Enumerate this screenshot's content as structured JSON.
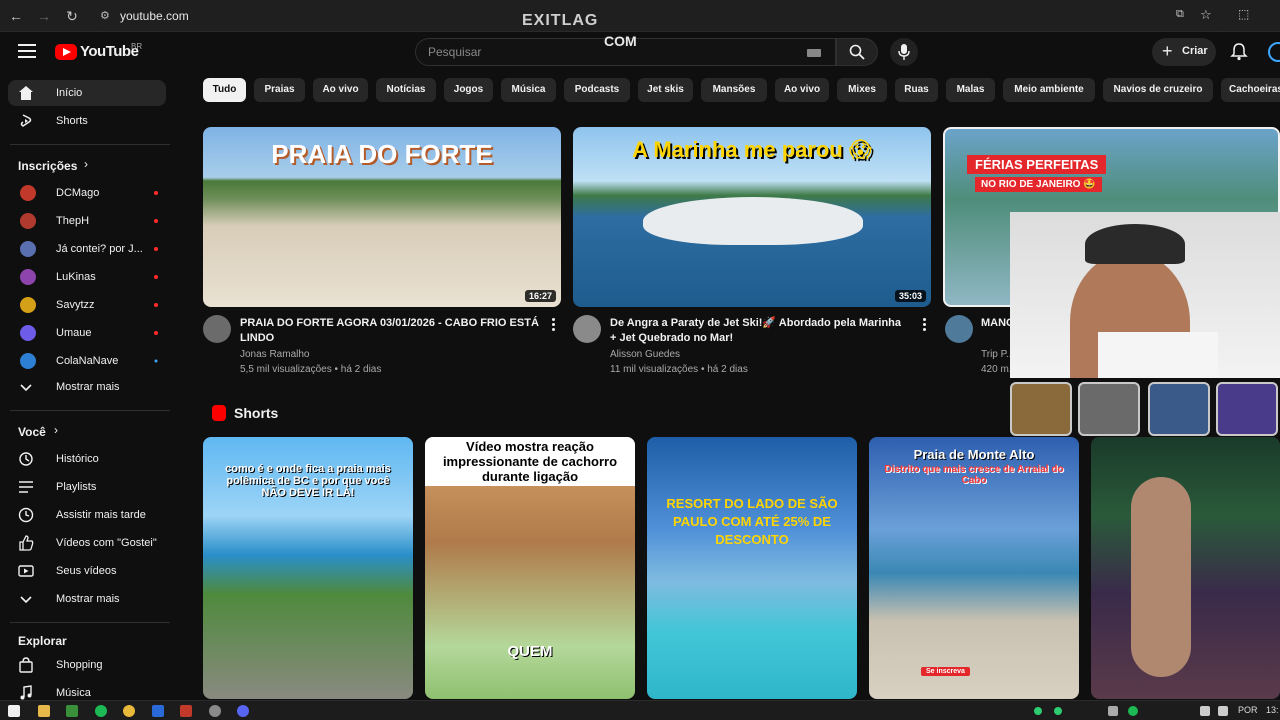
{
  "browser": {
    "url": "youtube.com",
    "overlay_logo": "EXITLAG",
    "overlay_sub": "COM"
  },
  "header": {
    "logo_text": "YouTube",
    "country_code": "BR",
    "search_placeholder": "Pesquisar",
    "create_label": "Criar"
  },
  "sidebar": {
    "main": [
      {
        "label": "Início",
        "icon": "home-icon"
      },
      {
        "label": "Shorts",
        "icon": "shorts-icon"
      }
    ],
    "subscriptions_heading": "Inscrições",
    "subscriptions": [
      {
        "label": "DCMago",
        "color": "#c0392b"
      },
      {
        "label": "ThepH",
        "color": "#b03a2e"
      },
      {
        "label": "Já contei? por J...",
        "color": "#5a6fb0"
      },
      {
        "label": "LuKinas",
        "color": "#8e44ad"
      },
      {
        "label": "Savytzz",
        "color": "#d4a017"
      },
      {
        "label": "Umaue",
        "color": "#6c5ce7"
      },
      {
        "label": "ColaNaNave",
        "color": "#2d7fd3"
      }
    ],
    "subscriptions_more": "Mostrar mais",
    "you_heading": "Você",
    "you_items": [
      {
        "label": "Histórico",
        "icon": "history-icon"
      },
      {
        "label": "Playlists",
        "icon": "playlist-icon"
      },
      {
        "label": "Assistir mais tarde",
        "icon": "clock-icon"
      },
      {
        "label": "Vídeos com \"Gostei\"",
        "icon": "thumb-up-icon"
      },
      {
        "label": "Seus vídeos",
        "icon": "video-icon"
      },
      {
        "label": "Mostrar mais",
        "icon": "chevron-down-icon"
      }
    ],
    "explore_heading": "Explorar",
    "explore_items": [
      {
        "label": "Shopping",
        "icon": "shopping-bag-icon"
      },
      {
        "label": "Música",
        "icon": "music-icon"
      }
    ]
  },
  "chips": [
    "Tudo",
    "Praias",
    "Ao vivo",
    "Notícias",
    "Jogos",
    "Música",
    "Podcasts",
    "Jet skis",
    "Mansões",
    "Ao vivo",
    "Mixes",
    "Ruas",
    "Malas",
    "Meio ambiente",
    "Navios de cruzeiro",
    "Cachoeiras"
  ],
  "videos": [
    {
      "thumb_text": "PRAIA DO FORTE",
      "duration": "16:27",
      "title": "PRAIA DO FORTE AGORA 03/01/2026 - CABO FRIO ESTÁ LINDO",
      "channel": "Jonas Ramalho",
      "stats": "5,5 mil visualizações • há 2 dias"
    },
    {
      "thumb_text": "A Marinha me parou 😱",
      "duration": "35:03",
      "title": "De Angra a Paraty de Jet Ski!🚀 Abordado pela Marinha + Jet Quebrado no Mar!",
      "channel": "Alisson Guedes",
      "stats": "11 mil visualizações • há 2 dias"
    },
    {
      "thumb_text_1": "FÉRIAS PERFEITAS",
      "thumb_text_2": "NO RIO DE JANEIRO 🤩",
      "title": "MANG... Janei...",
      "channel": "Trip P...",
      "stats": "420 m..."
    }
  ],
  "shorts_heading": "Shorts",
  "shorts": [
    {
      "text": "como é e onde fica a praia mais polêmica de BC e por que você NÃO DEVE IR LÁ!"
    },
    {
      "text": "Vídeo mostra reação impressionante de cachorro durante ligação",
      "caption": "QUEM"
    },
    {
      "text": "RESORT DO LADO DE SÃO PAULO COM ATÉ 25% DE DESCONTO"
    },
    {
      "text_1": "Praia de Monte Alto",
      "text_2": "Distrito que mais cresce de Arraial do Cabo",
      "caption": "Se inscreva"
    },
    {
      "text": ""
    }
  ],
  "taskbar": {
    "lang": "POR",
    "clock": "13:"
  }
}
